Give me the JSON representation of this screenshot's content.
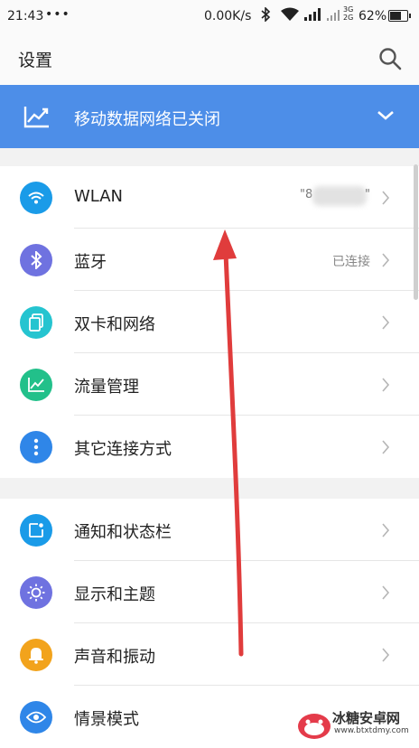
{
  "status_bar": {
    "time": "21:43",
    "dots": "•••",
    "speed": "0.00K/s",
    "net_top": "3G",
    "net_bottom": "2G",
    "battery": "62%"
  },
  "header": {
    "title": "设置",
    "search_icon": "search-icon"
  },
  "banner": {
    "text": "移动数据网络已关闭",
    "icon": "trend-icon",
    "color": "#4d8ee8"
  },
  "groups": [
    {
      "items": [
        {
          "label": "WLAN",
          "value": "\"8",
          "value_end": "\"",
          "icon": "wifi-icon",
          "color": "#1a9be8"
        },
        {
          "label": "蓝牙",
          "value": "已连接",
          "icon": "bluetooth-icon",
          "color": "#6f72e0"
        },
        {
          "label": "双卡和网络",
          "value": "",
          "icon": "dual-sim-icon",
          "color": "#25c4d0"
        },
        {
          "label": "流量管理",
          "value": "",
          "icon": "data-usage-icon",
          "color": "#22c08a"
        },
        {
          "label": "其它连接方式",
          "value": "",
          "icon": "more-connections-icon",
          "color": "#2f86e8"
        }
      ]
    },
    {
      "items": [
        {
          "label": "通知和状态栏",
          "value": "",
          "icon": "notification-icon",
          "color": "#1a9be8"
        },
        {
          "label": "显示和主题",
          "value": "",
          "icon": "display-icon",
          "color": "#6f72e0"
        },
        {
          "label": "声音和振动",
          "value": "",
          "icon": "bell-icon",
          "color": "#f2a31c"
        },
        {
          "label": "情景模式",
          "value": "",
          "icon": "eye-icon",
          "color": "#2f86e8"
        }
      ]
    }
  ],
  "watermark": {
    "name": "冰糖安卓网",
    "url": "www.btxtdmy.com"
  }
}
